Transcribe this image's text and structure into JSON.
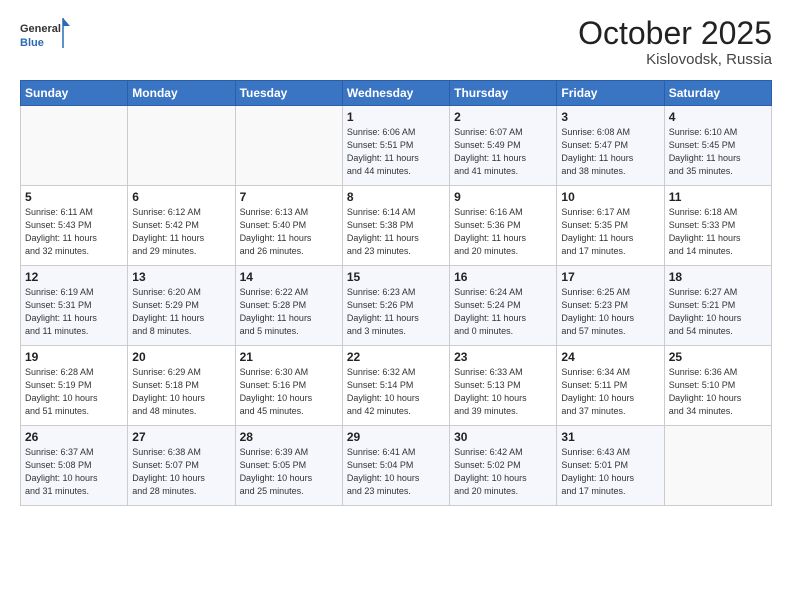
{
  "header": {
    "logo_general": "General",
    "logo_blue": "Blue",
    "month": "October 2025",
    "location": "Kislovodsk, Russia"
  },
  "days_of_week": [
    "Sunday",
    "Monday",
    "Tuesday",
    "Wednesday",
    "Thursday",
    "Friday",
    "Saturday"
  ],
  "weeks": [
    [
      {
        "day": "",
        "info": ""
      },
      {
        "day": "",
        "info": ""
      },
      {
        "day": "",
        "info": ""
      },
      {
        "day": "1",
        "info": "Sunrise: 6:06 AM\nSunset: 5:51 PM\nDaylight: 11 hours\nand 44 minutes."
      },
      {
        "day": "2",
        "info": "Sunrise: 6:07 AM\nSunset: 5:49 PM\nDaylight: 11 hours\nand 41 minutes."
      },
      {
        "day": "3",
        "info": "Sunrise: 6:08 AM\nSunset: 5:47 PM\nDaylight: 11 hours\nand 38 minutes."
      },
      {
        "day": "4",
        "info": "Sunrise: 6:10 AM\nSunset: 5:45 PM\nDaylight: 11 hours\nand 35 minutes."
      }
    ],
    [
      {
        "day": "5",
        "info": "Sunrise: 6:11 AM\nSunset: 5:43 PM\nDaylight: 11 hours\nand 32 minutes."
      },
      {
        "day": "6",
        "info": "Sunrise: 6:12 AM\nSunset: 5:42 PM\nDaylight: 11 hours\nand 29 minutes."
      },
      {
        "day": "7",
        "info": "Sunrise: 6:13 AM\nSunset: 5:40 PM\nDaylight: 11 hours\nand 26 minutes."
      },
      {
        "day": "8",
        "info": "Sunrise: 6:14 AM\nSunset: 5:38 PM\nDaylight: 11 hours\nand 23 minutes."
      },
      {
        "day": "9",
        "info": "Sunrise: 6:16 AM\nSunset: 5:36 PM\nDaylight: 11 hours\nand 20 minutes."
      },
      {
        "day": "10",
        "info": "Sunrise: 6:17 AM\nSunset: 5:35 PM\nDaylight: 11 hours\nand 17 minutes."
      },
      {
        "day": "11",
        "info": "Sunrise: 6:18 AM\nSunset: 5:33 PM\nDaylight: 11 hours\nand 14 minutes."
      }
    ],
    [
      {
        "day": "12",
        "info": "Sunrise: 6:19 AM\nSunset: 5:31 PM\nDaylight: 11 hours\nand 11 minutes."
      },
      {
        "day": "13",
        "info": "Sunrise: 6:20 AM\nSunset: 5:29 PM\nDaylight: 11 hours\nand 8 minutes."
      },
      {
        "day": "14",
        "info": "Sunrise: 6:22 AM\nSunset: 5:28 PM\nDaylight: 11 hours\nand 5 minutes."
      },
      {
        "day": "15",
        "info": "Sunrise: 6:23 AM\nSunset: 5:26 PM\nDaylight: 11 hours\nand 3 minutes."
      },
      {
        "day": "16",
        "info": "Sunrise: 6:24 AM\nSunset: 5:24 PM\nDaylight: 11 hours\nand 0 minutes."
      },
      {
        "day": "17",
        "info": "Sunrise: 6:25 AM\nSunset: 5:23 PM\nDaylight: 10 hours\nand 57 minutes."
      },
      {
        "day": "18",
        "info": "Sunrise: 6:27 AM\nSunset: 5:21 PM\nDaylight: 10 hours\nand 54 minutes."
      }
    ],
    [
      {
        "day": "19",
        "info": "Sunrise: 6:28 AM\nSunset: 5:19 PM\nDaylight: 10 hours\nand 51 minutes."
      },
      {
        "day": "20",
        "info": "Sunrise: 6:29 AM\nSunset: 5:18 PM\nDaylight: 10 hours\nand 48 minutes."
      },
      {
        "day": "21",
        "info": "Sunrise: 6:30 AM\nSunset: 5:16 PM\nDaylight: 10 hours\nand 45 minutes."
      },
      {
        "day": "22",
        "info": "Sunrise: 6:32 AM\nSunset: 5:14 PM\nDaylight: 10 hours\nand 42 minutes."
      },
      {
        "day": "23",
        "info": "Sunrise: 6:33 AM\nSunset: 5:13 PM\nDaylight: 10 hours\nand 39 minutes."
      },
      {
        "day": "24",
        "info": "Sunrise: 6:34 AM\nSunset: 5:11 PM\nDaylight: 10 hours\nand 37 minutes."
      },
      {
        "day": "25",
        "info": "Sunrise: 6:36 AM\nSunset: 5:10 PM\nDaylight: 10 hours\nand 34 minutes."
      }
    ],
    [
      {
        "day": "26",
        "info": "Sunrise: 6:37 AM\nSunset: 5:08 PM\nDaylight: 10 hours\nand 31 minutes."
      },
      {
        "day": "27",
        "info": "Sunrise: 6:38 AM\nSunset: 5:07 PM\nDaylight: 10 hours\nand 28 minutes."
      },
      {
        "day": "28",
        "info": "Sunrise: 6:39 AM\nSunset: 5:05 PM\nDaylight: 10 hours\nand 25 minutes."
      },
      {
        "day": "29",
        "info": "Sunrise: 6:41 AM\nSunset: 5:04 PM\nDaylight: 10 hours\nand 23 minutes."
      },
      {
        "day": "30",
        "info": "Sunrise: 6:42 AM\nSunset: 5:02 PM\nDaylight: 10 hours\nand 20 minutes."
      },
      {
        "day": "31",
        "info": "Sunrise: 6:43 AM\nSunset: 5:01 PM\nDaylight: 10 hours\nand 17 minutes."
      },
      {
        "day": "",
        "info": ""
      }
    ]
  ]
}
